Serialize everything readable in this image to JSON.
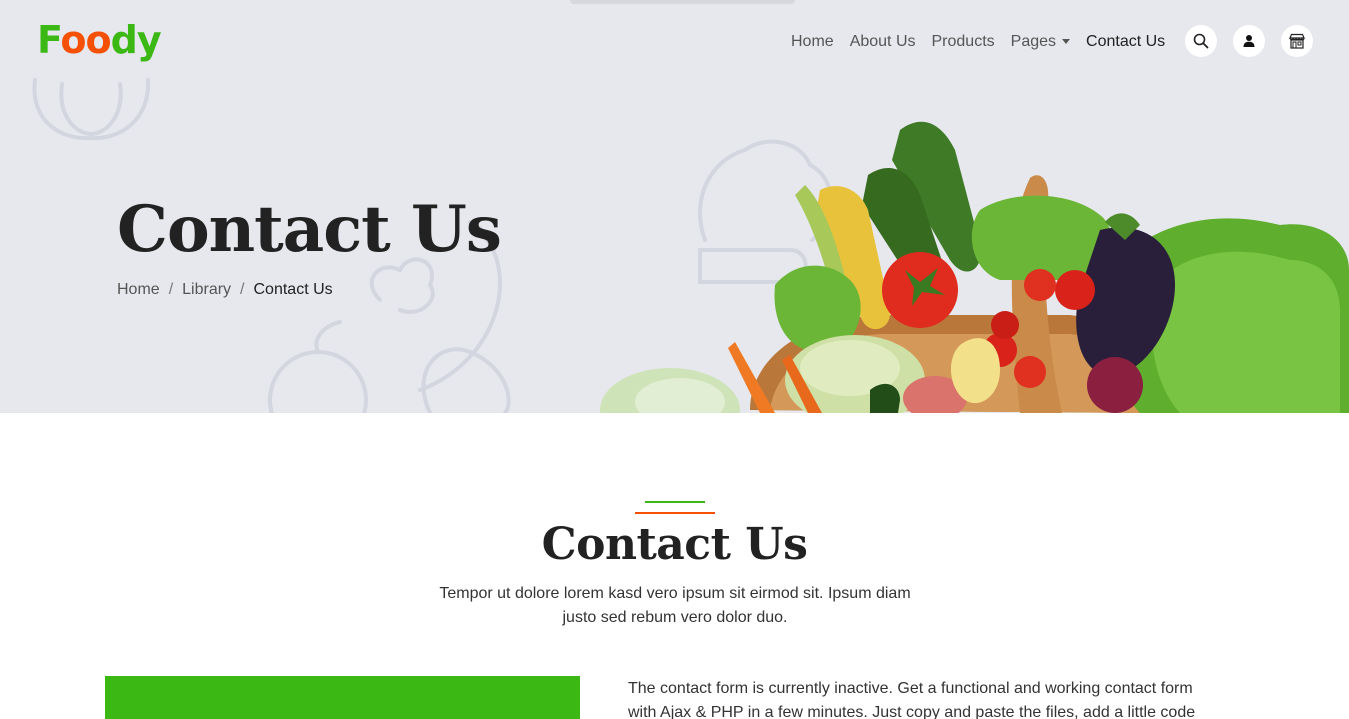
{
  "brand": {
    "part1": "F",
    "part2": "oo",
    "part3": "dy"
  },
  "nav": {
    "links": [
      "Home",
      "About Us",
      "Products",
      "Pages",
      "Contact Us"
    ],
    "active_index": 4
  },
  "icons": {
    "search": "search-icon",
    "user": "user-icon",
    "cart": "shop-icon"
  },
  "hero": {
    "title": "Contact Us",
    "breadcrumb": [
      "Home",
      "Library",
      "Contact Us"
    ],
    "separator": "/"
  },
  "section": {
    "title": "Contact Us",
    "subtitle": "Tempor ut dolore lorem kasd vero ipsum sit eirmod sit. Ipsum diam justo sed rebum vero dolor duo.",
    "note": "The contact form is currently inactive. Get a functional and working contact form with Ajax & PHP in a few minutes. Just copy and paste the files, add a little code"
  },
  "colors": {
    "green": "#3cb815",
    "orange": "#f65005",
    "hero_bg": "#e6e8ee",
    "dark": "#222222"
  }
}
